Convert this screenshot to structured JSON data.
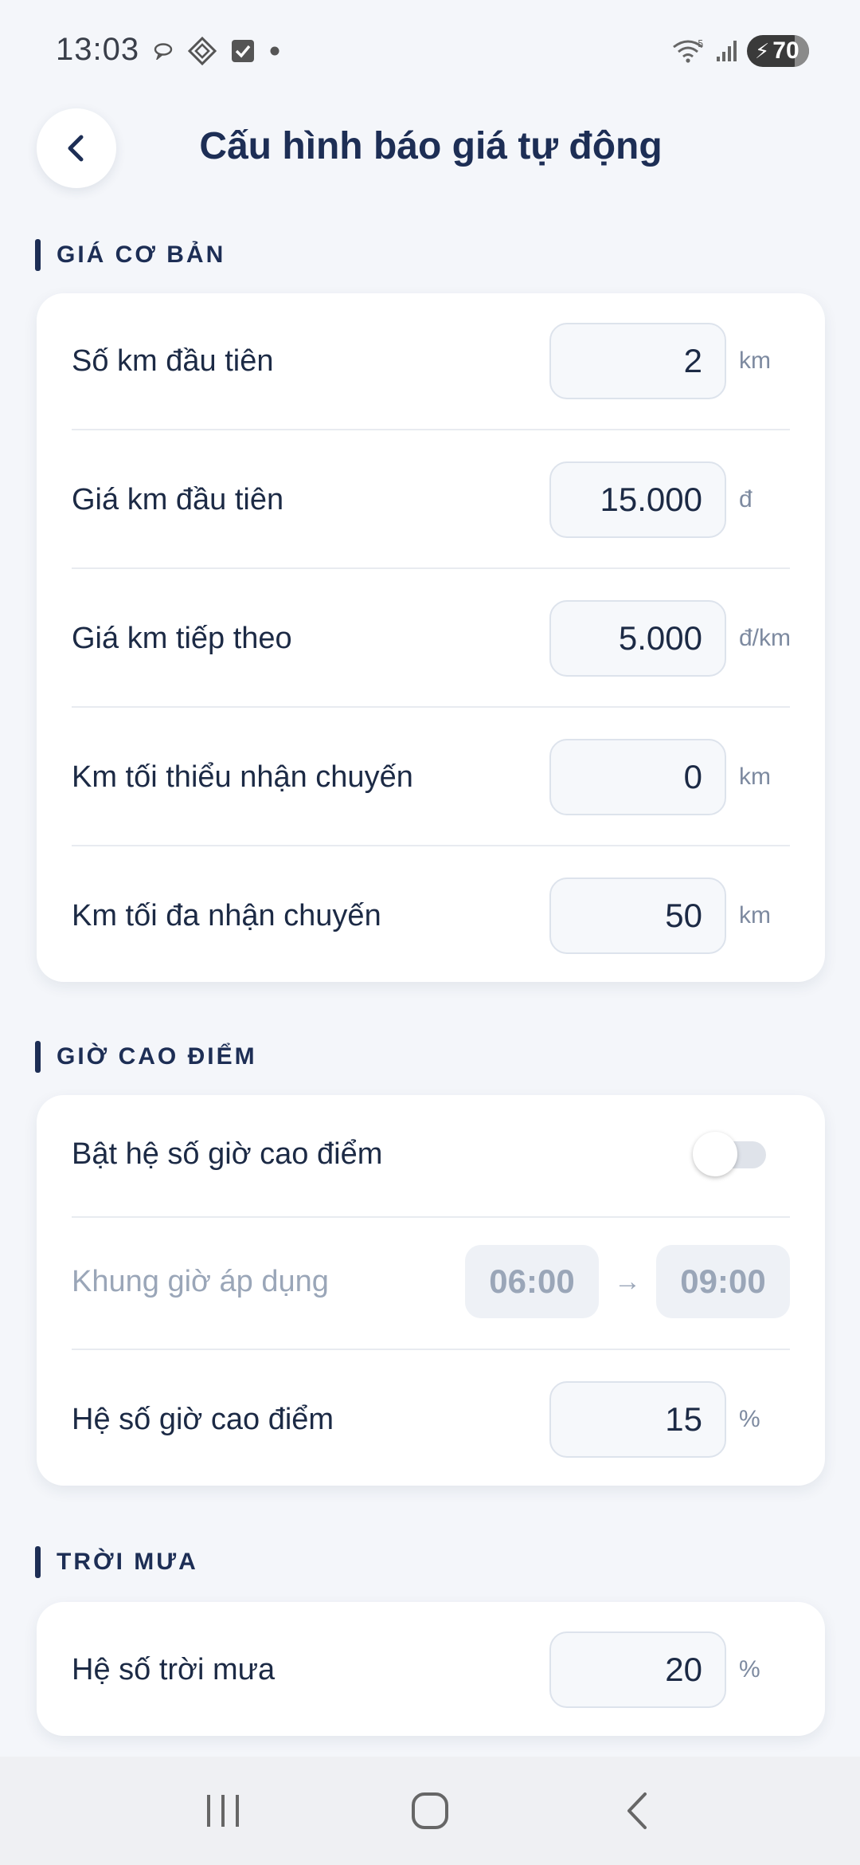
{
  "status_bar": {
    "time": "13:03",
    "battery": "70",
    "icons": [
      "chat-bubble-icon",
      "diamond-app-icon",
      "checkbox-app-icon",
      "dot-icon",
      "wifi-icon",
      "signal-icon",
      "battery-charging-icon"
    ]
  },
  "header": {
    "title": "Cấu hình báo giá tự động",
    "back_icon": "chevron-left-icon"
  },
  "sections": {
    "base": {
      "title": "GIÁ CƠ BẢN",
      "rows": [
        {
          "label": "Số km đầu tiên",
          "value": "2",
          "unit": "km"
        },
        {
          "label": "Giá km đầu tiên",
          "value": "15.000",
          "unit": "đ"
        },
        {
          "label": "Giá km tiếp theo",
          "value": "5.000",
          "unit": "đ/km"
        },
        {
          "label": "Km tối thiểu nhận chuyến",
          "value": "0",
          "unit": "km"
        },
        {
          "label": "Km tối đa nhận chuyến",
          "value": "50",
          "unit": "km"
        }
      ]
    },
    "peak": {
      "title": "GIỜ CAO ĐIỂM",
      "toggle_label": "Bật hệ số giờ cao điểm",
      "toggle_on": false,
      "window_label": "Khung giờ áp dụng",
      "start_time": "06:00",
      "end_time": "09:00",
      "arrow": "→",
      "factor_label": "Hệ số giờ cao điểm",
      "factor_value": "15",
      "factor_unit": "%"
    },
    "rain": {
      "title": "TRỜI MƯA",
      "factor_label": "Hệ số trời mưa",
      "factor_value": "20",
      "factor_unit": "%"
    }
  },
  "nav": {
    "icons": [
      "recent-apps-icon",
      "home-icon",
      "back-icon"
    ]
  }
}
